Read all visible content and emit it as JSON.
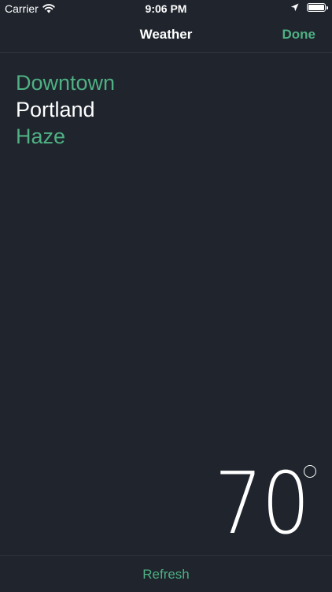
{
  "status_bar": {
    "carrier": "Carrier",
    "time": "9:06 PM",
    "icons": [
      "wifi-icon",
      "location-arrow-icon",
      "battery-icon"
    ],
    "battery_level": 1.0
  },
  "nav": {
    "title": "Weather",
    "done_label": "Done"
  },
  "weather": {
    "neighborhood": "Downtown",
    "city": "Portland",
    "condition": "Haze",
    "temperature": "70"
  },
  "footer": {
    "refresh_label": "Refresh"
  },
  "colors": {
    "background": "#1f242d",
    "accent": "#4fb083",
    "text": "#ffffff"
  }
}
